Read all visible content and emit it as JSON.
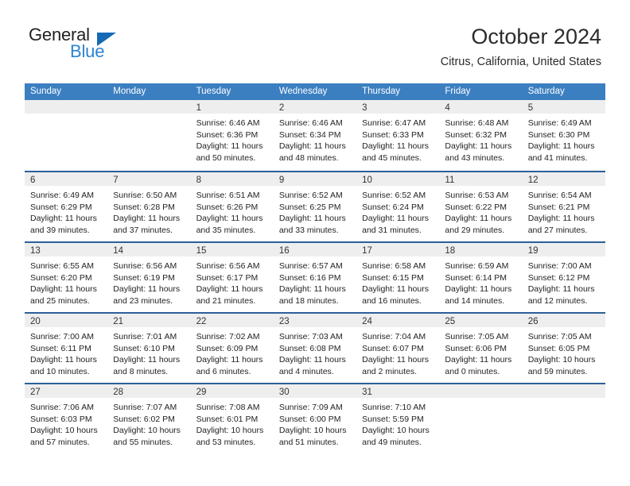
{
  "brand": {
    "name_primary": "General",
    "name_secondary": "Blue",
    "triangle_color": "#1669b5",
    "secondary_color": "#2a82d4"
  },
  "header": {
    "month_title": "October 2024",
    "location": "Citrus, California, United States"
  },
  "theme": {
    "header_row_bg": "#3c7fc1",
    "week_divider": "#2a6099",
    "day_band_bg": "#eeeeee",
    "text_color": "#232323"
  },
  "weekdays": [
    "Sunday",
    "Monday",
    "Tuesday",
    "Wednesday",
    "Thursday",
    "Friday",
    "Saturday"
  ],
  "weeks": [
    [
      {
        "day": "",
        "sunrise": "",
        "sunset": "",
        "daylight1": "",
        "daylight2": "",
        "empty": true
      },
      {
        "day": "",
        "sunrise": "",
        "sunset": "",
        "daylight1": "",
        "daylight2": "",
        "empty": true
      },
      {
        "day": "1",
        "sunrise": "Sunrise: 6:46 AM",
        "sunset": "Sunset: 6:36 PM",
        "daylight1": "Daylight: 11 hours",
        "daylight2": "and 50 minutes."
      },
      {
        "day": "2",
        "sunrise": "Sunrise: 6:46 AM",
        "sunset": "Sunset: 6:34 PM",
        "daylight1": "Daylight: 11 hours",
        "daylight2": "and 48 minutes."
      },
      {
        "day": "3",
        "sunrise": "Sunrise: 6:47 AM",
        "sunset": "Sunset: 6:33 PM",
        "daylight1": "Daylight: 11 hours",
        "daylight2": "and 45 minutes."
      },
      {
        "day": "4",
        "sunrise": "Sunrise: 6:48 AM",
        "sunset": "Sunset: 6:32 PM",
        "daylight1": "Daylight: 11 hours",
        "daylight2": "and 43 minutes."
      },
      {
        "day": "5",
        "sunrise": "Sunrise: 6:49 AM",
        "sunset": "Sunset: 6:30 PM",
        "daylight1": "Daylight: 11 hours",
        "daylight2": "and 41 minutes."
      }
    ],
    [
      {
        "day": "6",
        "sunrise": "Sunrise: 6:49 AM",
        "sunset": "Sunset: 6:29 PM",
        "daylight1": "Daylight: 11 hours",
        "daylight2": "and 39 minutes."
      },
      {
        "day": "7",
        "sunrise": "Sunrise: 6:50 AM",
        "sunset": "Sunset: 6:28 PM",
        "daylight1": "Daylight: 11 hours",
        "daylight2": "and 37 minutes."
      },
      {
        "day": "8",
        "sunrise": "Sunrise: 6:51 AM",
        "sunset": "Sunset: 6:26 PM",
        "daylight1": "Daylight: 11 hours",
        "daylight2": "and 35 minutes."
      },
      {
        "day": "9",
        "sunrise": "Sunrise: 6:52 AM",
        "sunset": "Sunset: 6:25 PM",
        "daylight1": "Daylight: 11 hours",
        "daylight2": "and 33 minutes."
      },
      {
        "day": "10",
        "sunrise": "Sunrise: 6:52 AM",
        "sunset": "Sunset: 6:24 PM",
        "daylight1": "Daylight: 11 hours",
        "daylight2": "and 31 minutes."
      },
      {
        "day": "11",
        "sunrise": "Sunrise: 6:53 AM",
        "sunset": "Sunset: 6:22 PM",
        "daylight1": "Daylight: 11 hours",
        "daylight2": "and 29 minutes."
      },
      {
        "day": "12",
        "sunrise": "Sunrise: 6:54 AM",
        "sunset": "Sunset: 6:21 PM",
        "daylight1": "Daylight: 11 hours",
        "daylight2": "and 27 minutes."
      }
    ],
    [
      {
        "day": "13",
        "sunrise": "Sunrise: 6:55 AM",
        "sunset": "Sunset: 6:20 PM",
        "daylight1": "Daylight: 11 hours",
        "daylight2": "and 25 minutes."
      },
      {
        "day": "14",
        "sunrise": "Sunrise: 6:56 AM",
        "sunset": "Sunset: 6:19 PM",
        "daylight1": "Daylight: 11 hours",
        "daylight2": "and 23 minutes."
      },
      {
        "day": "15",
        "sunrise": "Sunrise: 6:56 AM",
        "sunset": "Sunset: 6:17 PM",
        "daylight1": "Daylight: 11 hours",
        "daylight2": "and 21 minutes."
      },
      {
        "day": "16",
        "sunrise": "Sunrise: 6:57 AM",
        "sunset": "Sunset: 6:16 PM",
        "daylight1": "Daylight: 11 hours",
        "daylight2": "and 18 minutes."
      },
      {
        "day": "17",
        "sunrise": "Sunrise: 6:58 AM",
        "sunset": "Sunset: 6:15 PM",
        "daylight1": "Daylight: 11 hours",
        "daylight2": "and 16 minutes."
      },
      {
        "day": "18",
        "sunrise": "Sunrise: 6:59 AM",
        "sunset": "Sunset: 6:14 PM",
        "daylight1": "Daylight: 11 hours",
        "daylight2": "and 14 minutes."
      },
      {
        "day": "19",
        "sunrise": "Sunrise: 7:00 AM",
        "sunset": "Sunset: 6:12 PM",
        "daylight1": "Daylight: 11 hours",
        "daylight2": "and 12 minutes."
      }
    ],
    [
      {
        "day": "20",
        "sunrise": "Sunrise: 7:00 AM",
        "sunset": "Sunset: 6:11 PM",
        "daylight1": "Daylight: 11 hours",
        "daylight2": "and 10 minutes."
      },
      {
        "day": "21",
        "sunrise": "Sunrise: 7:01 AM",
        "sunset": "Sunset: 6:10 PM",
        "daylight1": "Daylight: 11 hours",
        "daylight2": "and 8 minutes."
      },
      {
        "day": "22",
        "sunrise": "Sunrise: 7:02 AM",
        "sunset": "Sunset: 6:09 PM",
        "daylight1": "Daylight: 11 hours",
        "daylight2": "and 6 minutes."
      },
      {
        "day": "23",
        "sunrise": "Sunrise: 7:03 AM",
        "sunset": "Sunset: 6:08 PM",
        "daylight1": "Daylight: 11 hours",
        "daylight2": "and 4 minutes."
      },
      {
        "day": "24",
        "sunrise": "Sunrise: 7:04 AM",
        "sunset": "Sunset: 6:07 PM",
        "daylight1": "Daylight: 11 hours",
        "daylight2": "and 2 minutes."
      },
      {
        "day": "25",
        "sunrise": "Sunrise: 7:05 AM",
        "sunset": "Sunset: 6:06 PM",
        "daylight1": "Daylight: 11 hours",
        "daylight2": "and 0 minutes."
      },
      {
        "day": "26",
        "sunrise": "Sunrise: 7:05 AM",
        "sunset": "Sunset: 6:05 PM",
        "daylight1": "Daylight: 10 hours",
        "daylight2": "and 59 minutes."
      }
    ],
    [
      {
        "day": "27",
        "sunrise": "Sunrise: 7:06 AM",
        "sunset": "Sunset: 6:03 PM",
        "daylight1": "Daylight: 10 hours",
        "daylight2": "and 57 minutes."
      },
      {
        "day": "28",
        "sunrise": "Sunrise: 7:07 AM",
        "sunset": "Sunset: 6:02 PM",
        "daylight1": "Daylight: 10 hours",
        "daylight2": "and 55 minutes."
      },
      {
        "day": "29",
        "sunrise": "Sunrise: 7:08 AM",
        "sunset": "Sunset: 6:01 PM",
        "daylight1": "Daylight: 10 hours",
        "daylight2": "and 53 minutes."
      },
      {
        "day": "30",
        "sunrise": "Sunrise: 7:09 AM",
        "sunset": "Sunset: 6:00 PM",
        "daylight1": "Daylight: 10 hours",
        "daylight2": "and 51 minutes."
      },
      {
        "day": "31",
        "sunrise": "Sunrise: 7:10 AM",
        "sunset": "Sunset: 5:59 PM",
        "daylight1": "Daylight: 10 hours",
        "daylight2": "and 49 minutes."
      },
      {
        "day": "",
        "sunrise": "",
        "sunset": "",
        "daylight1": "",
        "daylight2": "",
        "empty": true
      },
      {
        "day": "",
        "sunrise": "",
        "sunset": "",
        "daylight1": "",
        "daylight2": "",
        "empty": true
      }
    ]
  ]
}
